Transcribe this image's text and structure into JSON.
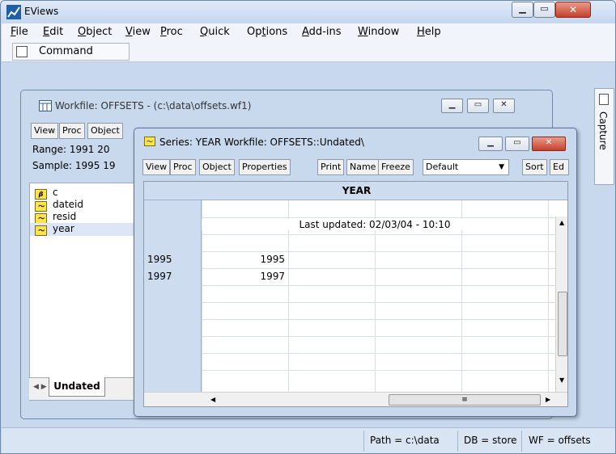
{
  "app": {
    "title": "EViews"
  },
  "menu": [
    {
      "label": "File",
      "ul": "F",
      "rest": "ile"
    },
    {
      "label": "Edit",
      "ul": "E",
      "rest": "dit"
    },
    {
      "label": "Object",
      "ul": "O",
      "rest": "bject"
    },
    {
      "label": "View",
      "ul": "V",
      "rest": "iew"
    },
    {
      "label": "Proc",
      "ul": "P",
      "rest": "roc"
    },
    {
      "label": "Quick",
      "ul": "Q",
      "rest": "uick"
    },
    {
      "label": "Options",
      "pre": "Op",
      "ul": "t",
      "rest": "ions"
    },
    {
      "label": "Add-ins",
      "ul": "A",
      "rest": "dd-ins"
    },
    {
      "label": "Window",
      "ul": "W",
      "rest": "indow"
    },
    {
      "label": "Help",
      "ul": "H",
      "rest": "elp"
    }
  ],
  "command": {
    "label": "Command"
  },
  "capture": {
    "label": "Capture"
  },
  "workfile": {
    "title": "Workfile: OFFSETS - (c:\\data\\offsets.wf1)",
    "toolbar": [
      "View",
      "Proc",
      "Object"
    ],
    "range": "Range:  1991 20",
    "sample": "Sample: 1995 19",
    "objects": [
      {
        "name": "c",
        "icon": "coef-icon"
      },
      {
        "name": "dateid",
        "icon": "series-icon"
      },
      {
        "name": "resid",
        "icon": "series-icon"
      },
      {
        "name": "year",
        "icon": "series-icon"
      }
    ],
    "tab": "Undated"
  },
  "series": {
    "title": "Series: YEAR   Workfile: OFFSETS::Undated\\",
    "toolbar": [
      "View",
      "Proc",
      "Object",
      "Properties",
      "Print",
      "Name",
      "Freeze"
    ],
    "dropdown": "Default",
    "toolbar_right": [
      "Sort",
      "Ed"
    ],
    "header": "YEAR",
    "last_updated": "Last updated: 02/03/04 - 10:10",
    "rows": [
      {
        "obs": "1995",
        "value": "1995"
      },
      {
        "obs": "1997",
        "value": "1997"
      }
    ]
  },
  "status": {
    "path": "Path = c:\\data",
    "db": "DB = store",
    "wf": "WF = offsets"
  }
}
